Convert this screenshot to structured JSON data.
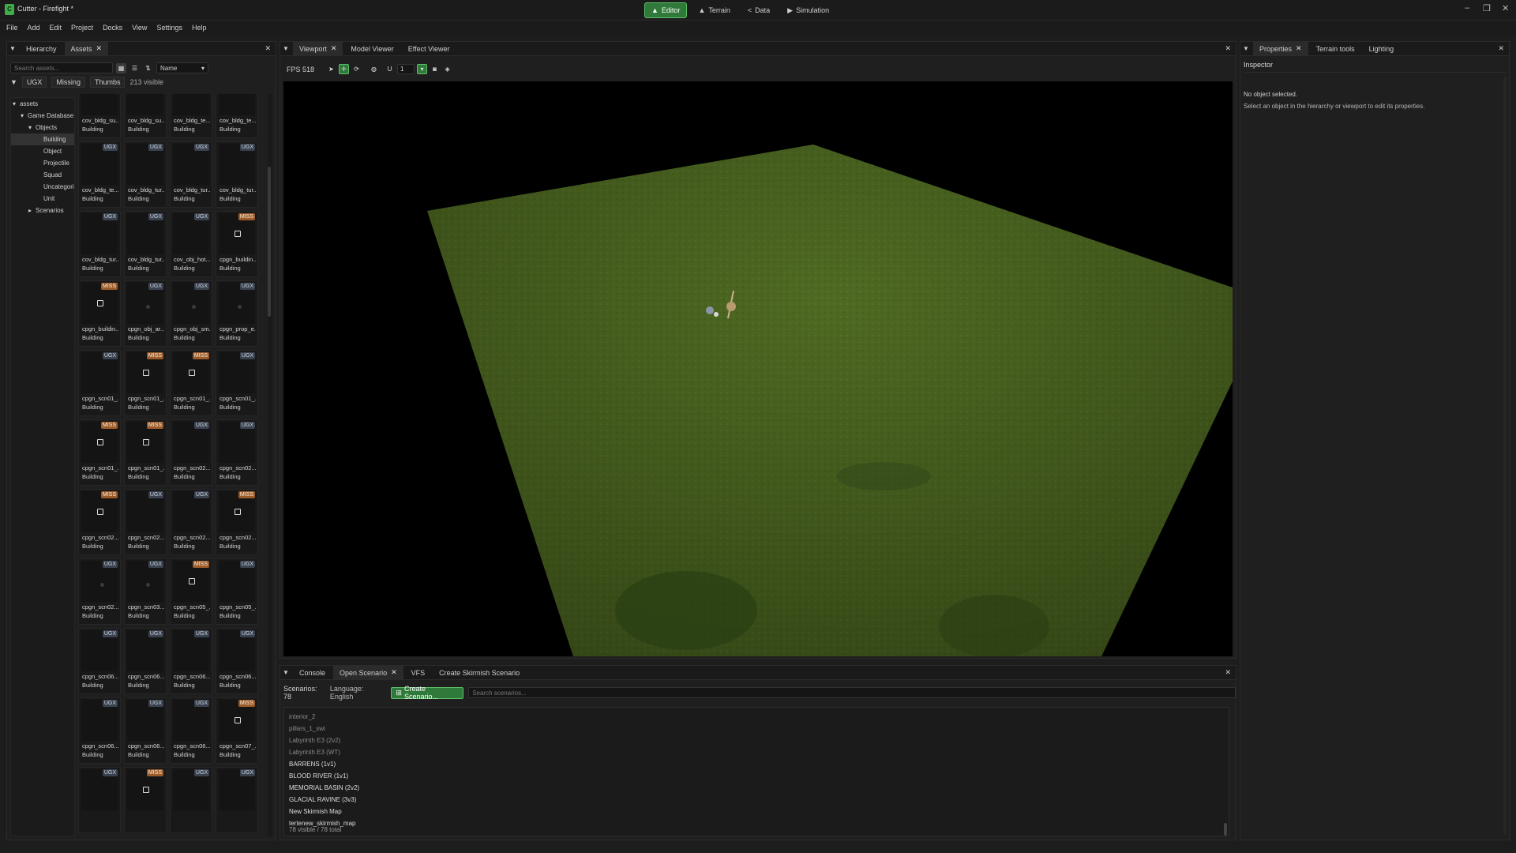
{
  "app": {
    "title": "Cutter - Firefight *"
  },
  "modes": [
    {
      "icon": "▲",
      "label": "Editor",
      "active": true
    },
    {
      "icon": "▲",
      "label": "Terrain",
      "active": false
    },
    {
      "icon": "<",
      "label": "Data",
      "active": false
    },
    {
      "icon": "▶",
      "label": "Simulation",
      "active": false
    }
  ],
  "window_controls": {
    "minimize": "–",
    "maximize": "❐",
    "close": "✕"
  },
  "menu": [
    "File",
    "Add",
    "Edit",
    "Project",
    "Docks",
    "View",
    "Settings",
    "Help"
  ],
  "left": {
    "tabs": [
      {
        "label": "Hierarchy",
        "active": false
      },
      {
        "label": "Assets",
        "active": true
      }
    ],
    "search_placeholder": "Search assets...",
    "sort": "Name",
    "filters": [
      "UGX",
      "Missing",
      "Thumbs"
    ],
    "visible_count": "213 visible",
    "tree": [
      {
        "label": "assets",
        "indent": 0,
        "arrow": "▾"
      },
      {
        "label": "Game Database",
        "indent": 1,
        "arrow": "▾"
      },
      {
        "label": "Objects",
        "indent": 2,
        "arrow": "▾"
      },
      {
        "label": "Building",
        "indent": 3,
        "arrow": "",
        "selected": true
      },
      {
        "label": "Object",
        "indent": 3,
        "arrow": ""
      },
      {
        "label": "Projectile",
        "indent": 3,
        "arrow": ""
      },
      {
        "label": "Squad",
        "indent": 3,
        "arrow": ""
      },
      {
        "label": "Uncategorized",
        "indent": 3,
        "arrow": ""
      },
      {
        "label": "Unit",
        "indent": 3,
        "arrow": ""
      },
      {
        "label": "Scenarios",
        "indent": 2,
        "arrow": "▸"
      }
    ],
    "assets": [
      {
        "name": "cov_bldg_su...",
        "type": "Building",
        "badge": "UGX",
        "thumb": "none"
      },
      {
        "name": "cov_bldg_su...",
        "type": "Building",
        "badge": "UGX",
        "thumb": "none"
      },
      {
        "name": "cov_bldg_te...",
        "type": "Building",
        "badge": "UGX",
        "thumb": "none"
      },
      {
        "name": "cov_bldg_te...",
        "type": "Building",
        "badge": "UGX",
        "thumb": "none"
      },
      {
        "name": "cov_bldg_te...",
        "type": "Building",
        "badge": "UGX",
        "thumb": "none"
      },
      {
        "name": "cov_bldg_tur...",
        "type": "Building",
        "badge": "UGX",
        "thumb": "none"
      },
      {
        "name": "cov_bldg_tur...",
        "type": "Building",
        "badge": "UGX",
        "thumb": "none"
      },
      {
        "name": "cov_bldg_tur...",
        "type": "Building",
        "badge": "UGX",
        "thumb": "none"
      },
      {
        "name": "cov_bldg_tur...",
        "type": "Building",
        "badge": "UGX",
        "thumb": "none"
      },
      {
        "name": "cov_bldg_tur...",
        "type": "Building",
        "badge": "UGX",
        "thumb": "none"
      },
      {
        "name": "cov_obj_hot...",
        "type": "Building",
        "badge": "UGX",
        "thumb": "none"
      },
      {
        "name": "cpgn_buildin...",
        "type": "Building",
        "badge": "MISS",
        "thumb": "img"
      },
      {
        "name": "cpgn_buildin...",
        "type": "Building",
        "badge": "MISS",
        "thumb": "img"
      },
      {
        "name": "cpgn_obj_ar...",
        "type": "Building",
        "badge": "UGX",
        "thumb": "dot"
      },
      {
        "name": "cpgn_obj_sm...",
        "type": "Building",
        "badge": "UGX",
        "thumb": "dot"
      },
      {
        "name": "cpgn_prop_e...",
        "type": "Building",
        "badge": "UGX",
        "thumb": "dot"
      },
      {
        "name": "cpgn_scn01_...",
        "type": "Building",
        "badge": "UGX",
        "thumb": "none"
      },
      {
        "name": "cpgn_scn01_...",
        "type": "Building",
        "badge": "MISS",
        "thumb": "img"
      },
      {
        "name": "cpgn_scn01_...",
        "type": "Building",
        "badge": "MISS",
        "thumb": "img"
      },
      {
        "name": "cpgn_scn01_...",
        "type": "Building",
        "badge": "UGX",
        "thumb": "none"
      },
      {
        "name": "cpgn_scn01_...",
        "type": "Building",
        "badge": "MISS",
        "thumb": "img"
      },
      {
        "name": "cpgn_scn01_...",
        "type": "Building",
        "badge": "MISS",
        "thumb": "img"
      },
      {
        "name": "cpgn_scn02...",
        "type": "Building",
        "badge": "UGX",
        "thumb": "none"
      },
      {
        "name": "cpgn_scn02...",
        "type": "Building",
        "badge": "UGX",
        "thumb": "none"
      },
      {
        "name": "cpgn_scn02...",
        "type": "Building",
        "badge": "MISS",
        "thumb": "img"
      },
      {
        "name": "cpgn_scn02...",
        "type": "Building",
        "badge": "UGX",
        "thumb": "none"
      },
      {
        "name": "cpgn_scn02...",
        "type": "Building",
        "badge": "UGX",
        "thumb": "none"
      },
      {
        "name": "cpgn_scn02...",
        "type": "Building",
        "badge": "MISS",
        "thumb": "img"
      },
      {
        "name": "cpgn_scn02...",
        "type": "Building",
        "badge": "UGX",
        "thumb": "dot"
      },
      {
        "name": "cpgn_scn03...",
        "type": "Building",
        "badge": "UGX",
        "thumb": "dot"
      },
      {
        "name": "cpgn_scn05_...",
        "type": "Building",
        "badge": "MISS",
        "thumb": "img"
      },
      {
        "name": "cpgn_scn05_...",
        "type": "Building",
        "badge": "UGX",
        "thumb": "none"
      },
      {
        "name": "cpgn_scn06...",
        "type": "Building",
        "badge": "UGX",
        "thumb": "none"
      },
      {
        "name": "cpgn_scn06...",
        "type": "Building",
        "badge": "UGX",
        "thumb": "none"
      },
      {
        "name": "cpgn_scn06...",
        "type": "Building",
        "badge": "UGX",
        "thumb": "none"
      },
      {
        "name": "cpgn_scn06...",
        "type": "Building",
        "badge": "UGX",
        "thumb": "none"
      },
      {
        "name": "cpgn_scn06...",
        "type": "Building",
        "badge": "UGX",
        "thumb": "none"
      },
      {
        "name": "cpgn_scn06...",
        "type": "Building",
        "badge": "UGX",
        "thumb": "none"
      },
      {
        "name": "cpgn_scn06...",
        "type": "Building",
        "badge": "UGX",
        "thumb": "none"
      },
      {
        "name": "cpgn_scn07_...",
        "type": "Building",
        "badge": "MISS",
        "thumb": "img"
      },
      {
        "name": "",
        "type": "",
        "badge": "UGX",
        "thumb": "none"
      },
      {
        "name": "",
        "type": "",
        "badge": "MISS",
        "thumb": "img"
      },
      {
        "name": "",
        "type": "",
        "badge": "UGX",
        "thumb": "none"
      },
      {
        "name": "",
        "type": "",
        "badge": "UGX",
        "thumb": "none"
      }
    ]
  },
  "center": {
    "tabs": [
      {
        "label": "Viewport",
        "active": true,
        "closable": true
      },
      {
        "label": "Model Viewer",
        "active": false
      },
      {
        "label": "Effect Viewer",
        "active": false
      }
    ],
    "fps": "FPS 518",
    "snap_value": "1"
  },
  "bottom": {
    "tabs": [
      {
        "label": "Console",
        "active": false
      },
      {
        "label": "Open Scenario",
        "active": true,
        "closable": true
      },
      {
        "label": "VFS",
        "active": false
      },
      {
        "label": "Create Skirmish Scenario",
        "active": false
      }
    ],
    "scenario_count": "Scenarios: 78",
    "language": "Language: English",
    "create_button": "Create Scenario...",
    "search_placeholder": "Search scenarios...",
    "scenarios": [
      {
        "name": "interior_2",
        "dim": true
      },
      {
        "name": "pillars_1_swi",
        "dim": true
      },
      {
        "name": "Labyrinth E3 (2v2)",
        "dim": true
      },
      {
        "name": "Labyrinth E3 (WT)",
        "dim": true
      },
      {
        "name": "BARRENS (1v1)",
        "dim": false
      },
      {
        "name": "BLOOD RIVER (1v1)",
        "dim": false
      },
      {
        "name": "MEMORIAL BASIN (2v2)",
        "dim": false
      },
      {
        "name": "GLACIAL RAVINE (3v3)",
        "dim": false
      },
      {
        "name": "New Skirmish Map",
        "dim": false
      },
      {
        "name": "tertenew_skirmish_map",
        "dim": false
      }
    ],
    "footer": "78 visible / 78 total"
  },
  "right": {
    "tabs": [
      {
        "label": "Properties",
        "active": true,
        "closable": true
      },
      {
        "label": "Terrain tools",
        "active": false
      },
      {
        "label": "Lighting",
        "active": false
      }
    ],
    "header": "Inspector",
    "empty_title": "No object selected.",
    "empty_hint": "Select an object in the hierarchy or viewport to edit its properties."
  },
  "colors": {
    "accent": "#2f7a3a",
    "ugx_badge": "#3a4250",
    "miss_badge": "#9a5a2a",
    "terrain": "#4f6a22"
  }
}
